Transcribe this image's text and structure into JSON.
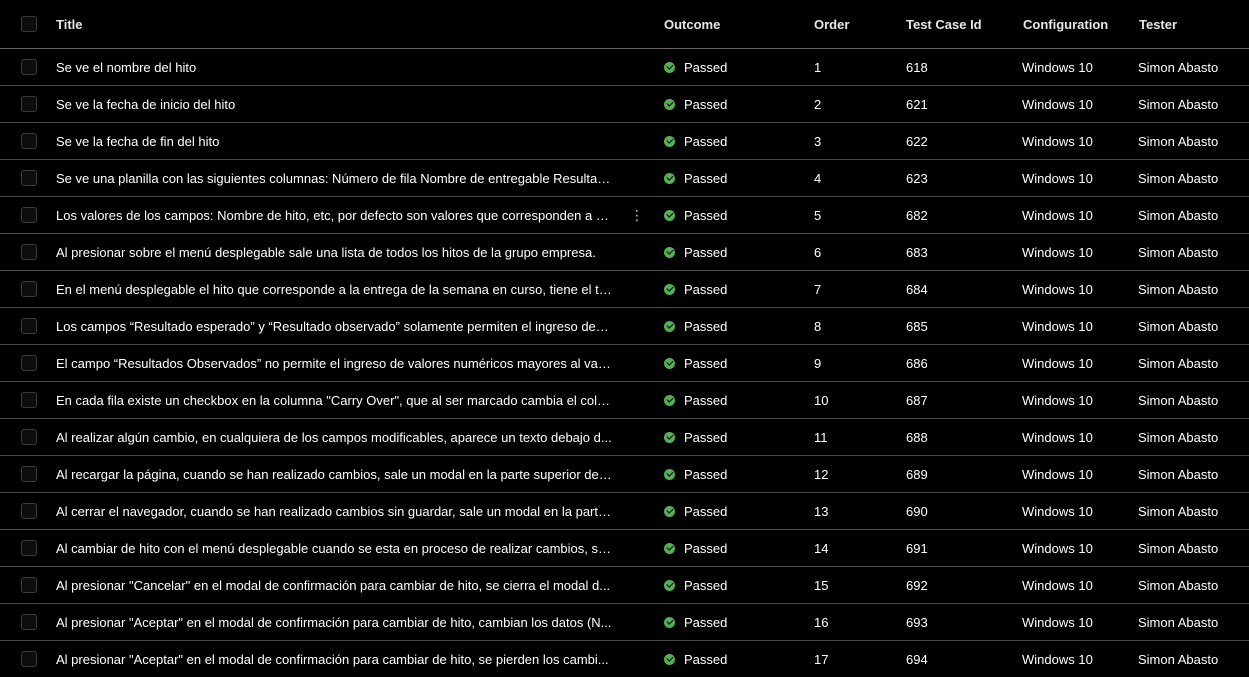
{
  "columns": {
    "title": "Title",
    "outcome": "Outcome",
    "order": "Order",
    "test_case_id": "Test Case Id",
    "configuration": "Configuration",
    "tester": "Tester"
  },
  "colors": {
    "background": "#000000",
    "passed_icon": "#54b054",
    "row_divider": "#4a4a4a"
  },
  "rows": [
    {
      "title": "Se ve el nombre del hito",
      "outcome": "Passed",
      "order": "1",
      "test_case_id": "618",
      "configuration": "Windows 10",
      "tester": "Simon Abasto"
    },
    {
      "title": "Se ve la fecha de inicio del hito",
      "outcome": "Passed",
      "order": "2",
      "test_case_id": "621",
      "configuration": "Windows 10",
      "tester": "Simon Abasto"
    },
    {
      "title": "Se ve la fecha de fin del hito",
      "outcome": "Passed",
      "order": "3",
      "test_case_id": "622",
      "configuration": "Windows 10",
      "tester": "Simon Abasto"
    },
    {
      "title": "Se ve una planilla con las siguientes columnas: Número de fila Nombre de entregable Resultad...",
      "outcome": "Passed",
      "order": "4",
      "test_case_id": "623",
      "configuration": "Windows 10",
      "tester": "Simon Abasto"
    },
    {
      "title": "Los valores de los campos: Nombre de hito, etc, por defecto son valores que corresponden a u...",
      "outcome": "Passed",
      "order": "5",
      "test_case_id": "682",
      "configuration": "Windows 10",
      "tester": "Simon Abasto",
      "more_icon": "more-vertical-icon"
    },
    {
      "title": "Al presionar sobre el menú desplegable sale una lista de todos los hitos de la grupo empresa.",
      "outcome": "Passed",
      "order": "6",
      "test_case_id": "683",
      "configuration": "Windows 10",
      "tester": "Simon Abasto"
    },
    {
      "title": "En el menú desplegable el hito que corresponde a la entrega de la semana en curso, tiene el te...",
      "outcome": "Passed",
      "order": "7",
      "test_case_id": "684",
      "configuration": "Windows 10",
      "tester": "Simon Abasto"
    },
    {
      "title": "Los campos “Resultado esperado” y “Resultado observado” solamente permiten el ingreso de n...",
      "outcome": "Passed",
      "order": "8",
      "test_case_id": "685",
      "configuration": "Windows 10",
      "tester": "Simon Abasto"
    },
    {
      "title": "El campo “Resultados Observados” no permite el ingreso de valores numéricos mayores al valo...",
      "outcome": "Passed",
      "order": "9",
      "test_case_id": "686",
      "configuration": "Windows 10",
      "tester": "Simon Abasto"
    },
    {
      "title": "En cada fila existe un checkbox en la columna \"Carry Over\", que al ser marcado cambia el color ...",
      "outcome": "Passed",
      "order": "10",
      "test_case_id": "687",
      "configuration": "Windows 10",
      "tester": "Simon Abasto"
    },
    {
      "title": "Al realizar algún cambio, en cualquiera de los campos modificables, aparece un texto debajo d...",
      "outcome": "Passed",
      "order": "11",
      "test_case_id": "688",
      "configuration": "Windows 10",
      "tester": "Simon Abasto"
    },
    {
      "title": "Al recargar la página, cuando se han realizado cambios, sale un modal en la parte superior de l...",
      "outcome": "Passed",
      "order": "12",
      "test_case_id": "689",
      "configuration": "Windows 10",
      "tester": "Simon Abasto"
    },
    {
      "title": "Al cerrar el navegador, cuando se han realizado cambios sin guardar, sale un modal en la parte ...",
      "outcome": "Passed",
      "order": "13",
      "test_case_id": "690",
      "configuration": "Windows 10",
      "tester": "Simon Abasto"
    },
    {
      "title": "Al cambiar de hito con el menú desplegable cuando se esta en proceso de realizar cambios, sal...",
      "outcome": "Passed",
      "order": "14",
      "test_case_id": "691",
      "configuration": "Windows 10",
      "tester": "Simon Abasto"
    },
    {
      "title": "Al presionar \"Cancelar\" en el modal de confirmación para cambiar de hito, se cierra el modal d...",
      "outcome": "Passed",
      "order": "15",
      "test_case_id": "692",
      "configuration": "Windows 10",
      "tester": "Simon Abasto"
    },
    {
      "title": "Al presionar \"Aceptar\" en el modal de confirmación para cambiar de hito, cambian los datos (N...",
      "outcome": "Passed",
      "order": "16",
      "test_case_id": "693",
      "configuration": "Windows 10",
      "tester": "Simon Abasto"
    },
    {
      "title": "Al presionar \"Aceptar\" en el modal de confirmación para cambiar de hito, se pierden los cambi...",
      "outcome": "Passed",
      "order": "17",
      "test_case_id": "694",
      "configuration": "Windows 10",
      "tester": "Simon Abasto"
    }
  ]
}
